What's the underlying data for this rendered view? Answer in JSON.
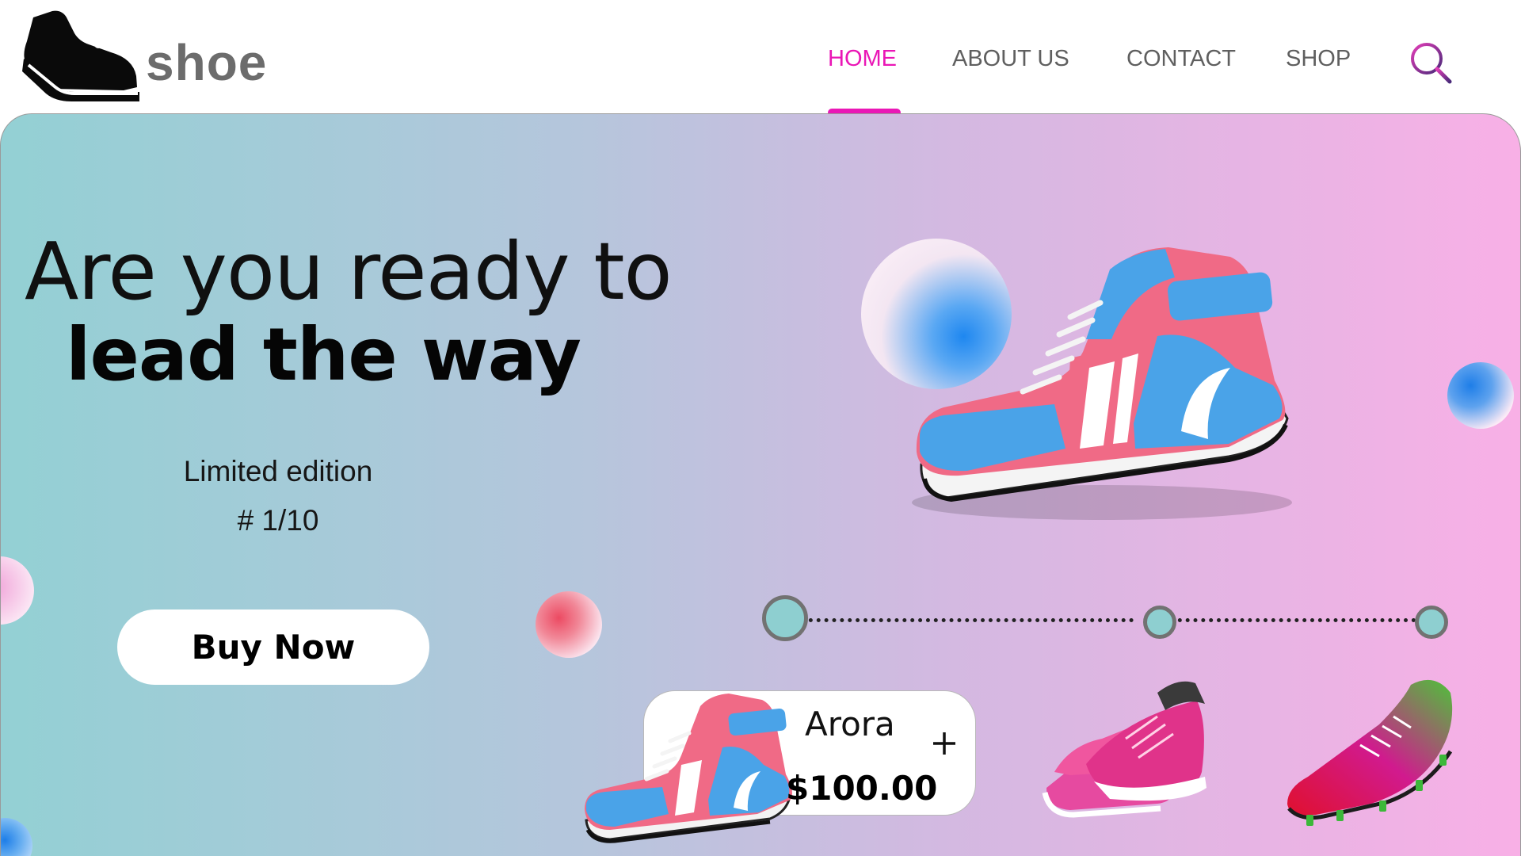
{
  "brand": {
    "name": "shoe",
    "logo_icon": "sneaker-logo-icon"
  },
  "nav": {
    "items": [
      {
        "label": "HOME",
        "active": true
      },
      {
        "label": "ABOUT US",
        "active": false
      },
      {
        "label": "CONTACT",
        "active": false
      },
      {
        "label": "SHOP",
        "active": false
      }
    ],
    "search_icon": "search-icon"
  },
  "colors": {
    "accent": "#ea17b6",
    "nav_text": "#5f5f5f",
    "gradient_start": "#93d0d4",
    "gradient_end": "#f8b0e6",
    "timeline_dot": "#8ecfd0"
  },
  "hero": {
    "headline_line1": "Are you ready to",
    "headline_line2": "lead the way",
    "subtitle_line1": "Limited edition",
    "subtitle_line2": "# 1/10",
    "cta_label": "Buy Now"
  },
  "product_card": {
    "name": "Arora",
    "price": "$100.00",
    "add_icon": "plus-icon"
  },
  "carousel": {
    "step_count": 3,
    "active_step": 1,
    "thumbnails": [
      "pink-running-shoe",
      "pink-green-football-boot"
    ]
  }
}
